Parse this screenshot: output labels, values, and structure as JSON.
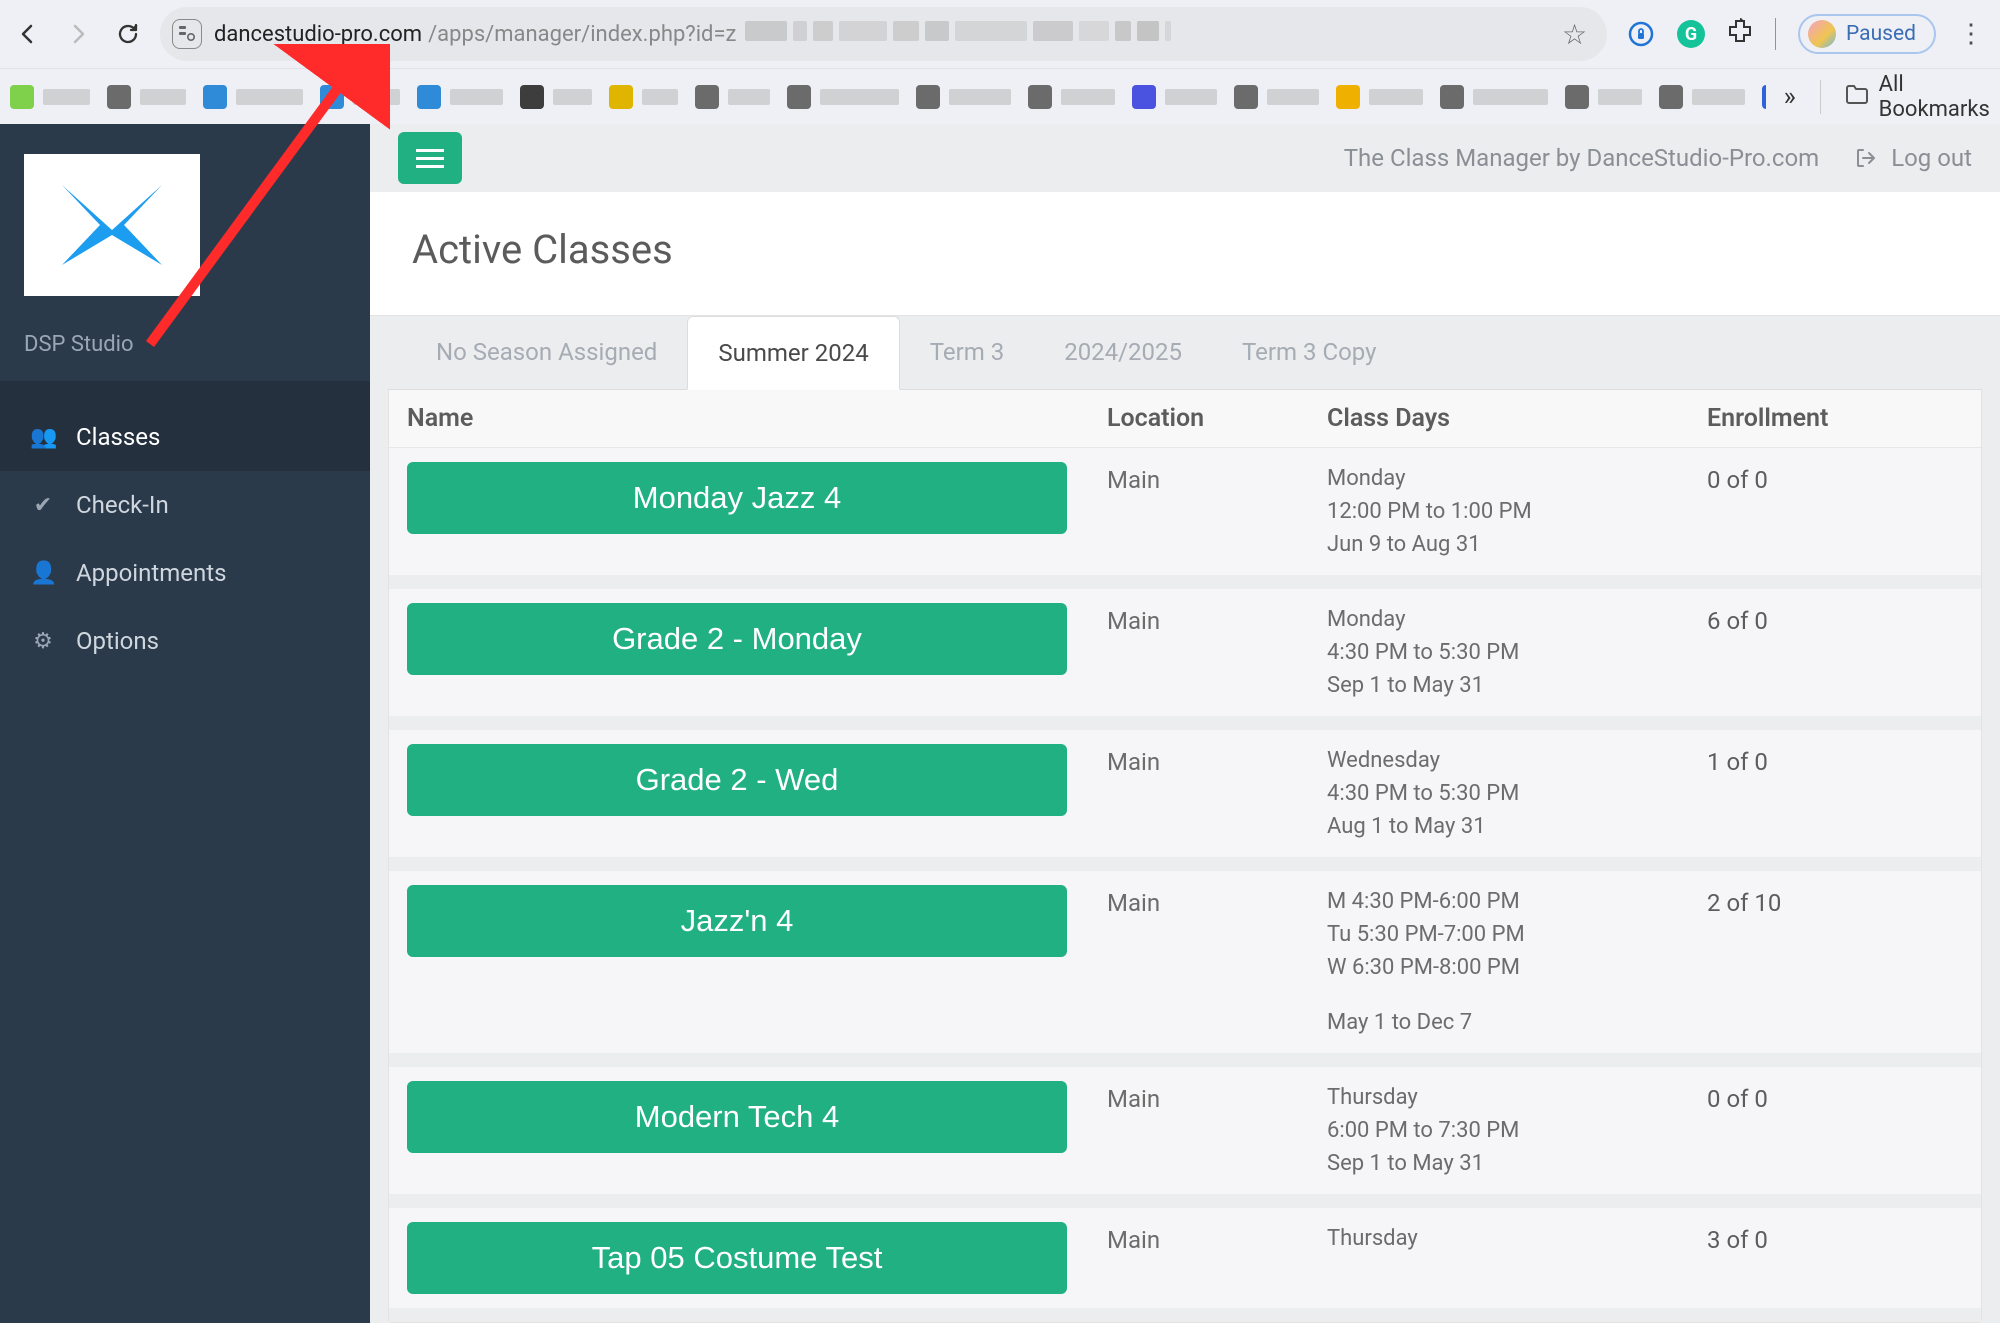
{
  "browser": {
    "url_domain": "dancestudio-pro.com",
    "url_path": "/apps/manager/index.php?id=z",
    "paused_label": "Paused",
    "all_bookmarks_label": "All Bookmarks"
  },
  "sidebar": {
    "studio_name": "DSP Studio",
    "items": [
      {
        "label": "Classes",
        "icon": "users-icon",
        "active": true
      },
      {
        "label": "Check-In",
        "icon": "check-icon",
        "active": false
      },
      {
        "label": "Appointments",
        "icon": "user-icon",
        "active": false
      },
      {
        "label": "Options",
        "icon": "gear-icon",
        "active": false
      }
    ]
  },
  "topbar": {
    "brand_text": "The Class Manager by DanceStudio-Pro.com",
    "logout_label": "Log out"
  },
  "page": {
    "title": "Active Classes"
  },
  "tabs": [
    {
      "label": "No Season Assigned",
      "active": false
    },
    {
      "label": "Summer 2024",
      "active": true
    },
    {
      "label": "Term 3",
      "active": false
    },
    {
      "label": "2024/2025",
      "active": false
    },
    {
      "label": "Term 3 Copy",
      "active": false
    }
  ],
  "table": {
    "headers": {
      "name": "Name",
      "location": "Location",
      "days": "Class Days",
      "enrollment": "Enrollment"
    },
    "rows": [
      {
        "name": "Monday Jazz 4",
        "location": "Main",
        "days_lines": [
          "Monday",
          "12:00 PM to 1:00 PM",
          "Jun 9 to Aug 31"
        ],
        "enrollment": "0 of 0"
      },
      {
        "name": "Grade 2 - Monday",
        "location": "Main",
        "days_lines": [
          "Monday",
          "4:30 PM to 5:30 PM",
          "Sep 1 to May 31"
        ],
        "enrollment": "6 of 0"
      },
      {
        "name": "Grade 2 - Wed",
        "location": "Main",
        "days_lines": [
          "Wednesday",
          "4:30 PM to 5:30 PM",
          "Aug 1 to May 31"
        ],
        "enrollment": "1 of 0"
      },
      {
        "name": "Jazz'n 4",
        "location": "Main",
        "days_lines": [
          "M 4:30 PM-6:00 PM",
          "Tu 5:30 PM-7:00 PM",
          "W 6:30 PM-8:00 PM",
          "",
          "May 1 to Dec 7"
        ],
        "enrollment": "2 of 10"
      },
      {
        "name": "Modern Tech 4",
        "location": "Main",
        "days_lines": [
          "Thursday",
          "6:00 PM to 7:30 PM",
          "Sep 1 to May 31"
        ],
        "enrollment": "0 of 0"
      },
      {
        "name": "Tap 05 Costume Test",
        "location": "Main",
        "days_lines": [
          "Thursday"
        ],
        "enrollment": "3 of 0"
      }
    ]
  },
  "bookmark_icon_colors": [
    "#7fd04a",
    "#6b6b6b",
    "#2f8bd8",
    "#2f8bd8",
    "#2f8bd8",
    "#3d3d3d",
    "#e0b500",
    "#6b6b6b",
    "#6b6b6b",
    "#6b6b6b",
    "#6b6b6b",
    "#4a52e0",
    "#6b6b6b",
    "#f0b000",
    "#6b6b6b",
    "#6b6b6b",
    "#6b6b6b",
    "#2f63d8",
    "#6b6b6b",
    "#f0b000",
    "#6b6b6b"
  ]
}
